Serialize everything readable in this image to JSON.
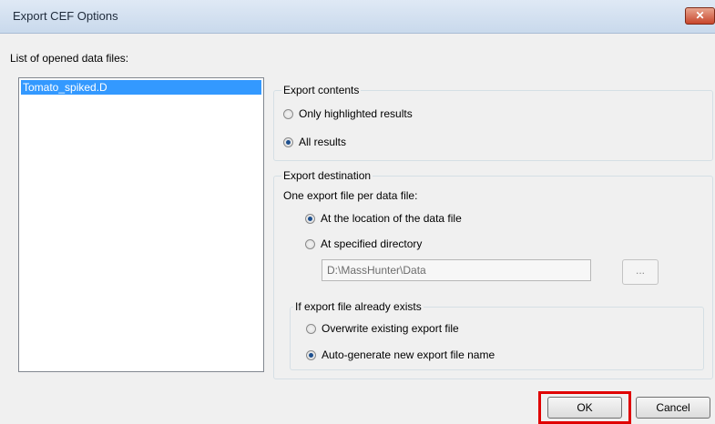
{
  "dialog": {
    "title": "Export CEF Options",
    "close_glyph": "✕"
  },
  "files": {
    "label": "List of opened data files:",
    "items": [
      "Tomato_spiked.D"
    ]
  },
  "export_contents": {
    "legend": "Export contents",
    "options": [
      "Only highlighted results",
      "All results"
    ],
    "selected": "All results"
  },
  "export_destination": {
    "legend": "Export destination",
    "subheading": "One export file per data file:",
    "options": [
      "At the location of the data file",
      "At specified directory"
    ],
    "selected": "At the location of the data file",
    "directory_value": "D:\\MassHunter\\Data",
    "browse_label": "..."
  },
  "if_exists": {
    "legend": "If export file already exists",
    "options": [
      "Overwrite existing export file",
      "Auto-generate new export file name"
    ],
    "selected": "Auto-generate new export file name"
  },
  "buttons": {
    "ok": "OK",
    "cancel": "Cancel"
  },
  "colors": {
    "selection": "#3399ff",
    "highlight_box": "#e00000"
  }
}
